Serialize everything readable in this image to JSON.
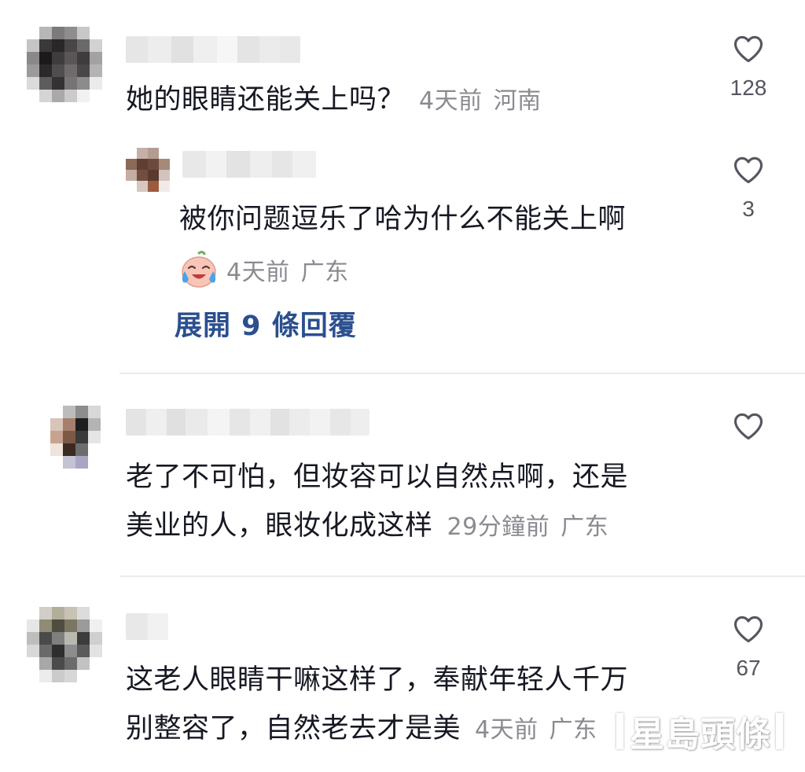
{
  "comments": [
    {
      "text_lines": [
        "她的眼睛还能关上吗？"
      ],
      "time": "4天前",
      "location": "河南",
      "likes": "128",
      "reply": {
        "text": "被你问题逗乐了哈为什么不能关上啊",
        "emoji": "crying-laughing-emoji",
        "time": "4天前",
        "location": "广东",
        "likes": "3"
      },
      "expand_label": "展開 9 條回覆"
    },
    {
      "text_lines": [
        "老了不可怕，但妆容可以自然点啊，还是",
        "美业的人，眼妆化成这样"
      ],
      "time": "29分鐘前",
      "location": "广东",
      "likes": ""
    },
    {
      "text_lines": [
        "这老人眼睛干嘛这样了，奉献年轻人千万",
        "别整容了，自然老去才是美"
      ],
      "time": "4天前",
      "location": "广东",
      "likes": "67"
    }
  ],
  "watermark": "星島頭條",
  "colors": {
    "text": "#161823",
    "meta": "#8a8b91",
    "link": "#2b4f8f",
    "divider": "#ececee"
  },
  "icons": [
    "heart-outline-icon",
    "crying-laughing-emoji"
  ]
}
